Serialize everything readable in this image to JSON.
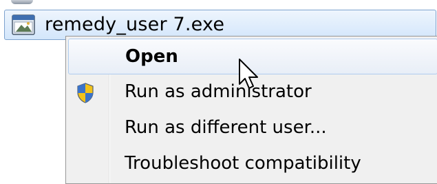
{
  "file": {
    "name": "remedy_user 7.exe",
    "icon": "application-exe-icon"
  },
  "context_menu": {
    "items": [
      {
        "label": "Open",
        "bold": true,
        "selected": true,
        "icon": null
      },
      {
        "label": "Run as administrator",
        "bold": false,
        "selected": false,
        "icon": "uac-shield-icon"
      },
      {
        "label": "Run as different user...",
        "bold": false,
        "selected": false,
        "icon": null
      },
      {
        "label": "Troubleshoot compatibility",
        "bold": false,
        "selected": false,
        "icon": null
      }
    ]
  },
  "colors": {
    "selection_border": "#7da2ce",
    "menu_background": "#f0f0f0"
  }
}
